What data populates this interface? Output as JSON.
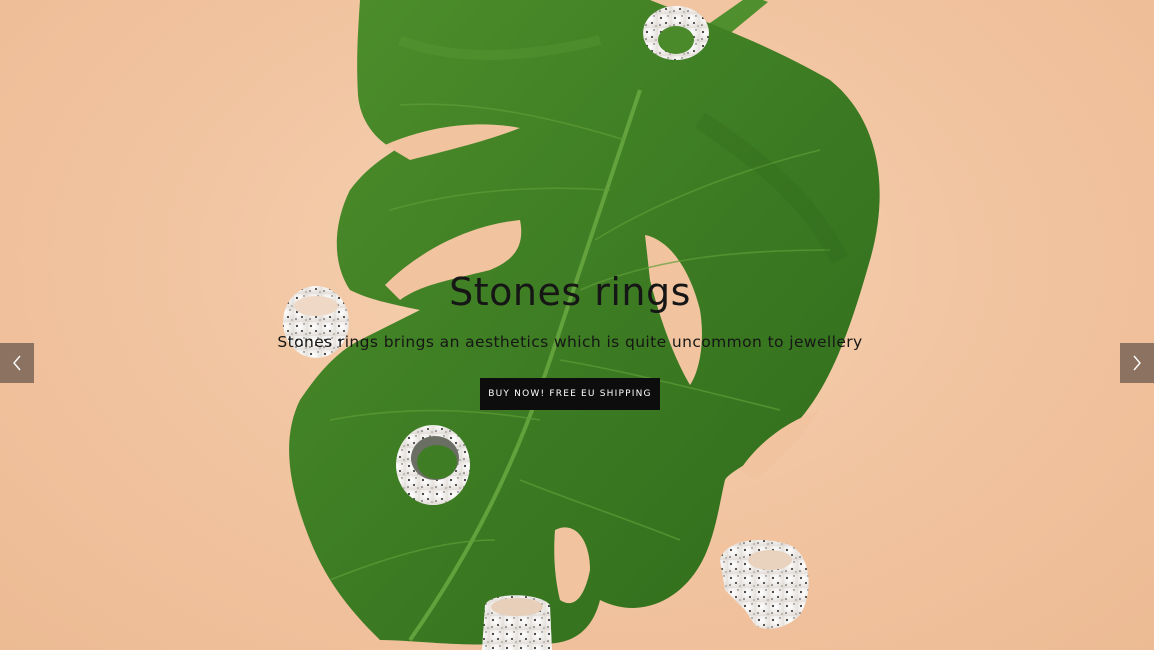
{
  "slide": {
    "title": "Stones rings",
    "subtitle": "Stones rings brings an aesthetics which is quite uncommon to jewellery",
    "cta_label": "BUY NOW! FREE EU SHIPPING",
    "image_alt": "Monstera leaf with white speckled stone rings on peach background"
  },
  "controls": {
    "prev_icon": "chevron-left-icon",
    "next_icon": "chevron-right-icon"
  },
  "colors": {
    "background": "#f3c9a6",
    "leaf": "#3f7d24",
    "button": "#0d0d0d",
    "arrow_bg": "#705c50"
  }
}
